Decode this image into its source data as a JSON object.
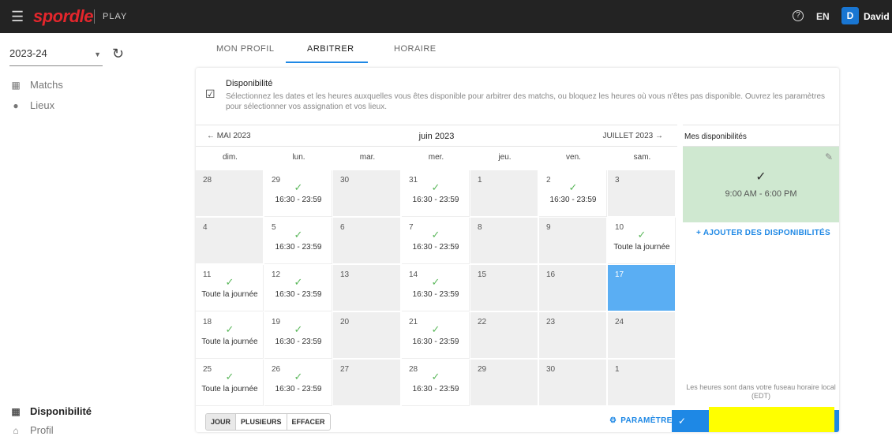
{
  "topbar": {
    "menu_icon": "menu-icon",
    "brand": "spordle",
    "product": "PLAY",
    "help_icon": "help-icon",
    "help_glyph": "?",
    "language": "EN",
    "user_initial": "D",
    "user_name": "David"
  },
  "sidebar": {
    "season": "2023-24",
    "items": [
      {
        "label": "Matchs",
        "icon": "matches-icon"
      },
      {
        "label": "Lieux",
        "icon": "location-pin-icon"
      }
    ],
    "bottom_items": [
      {
        "label": "Disponibilité",
        "icon": "calendar-icon"
      },
      {
        "label": "Profil",
        "icon": "home-icon"
      }
    ]
  },
  "tabs": [
    "MON PROFIL",
    "ARBITRER",
    "HORAIRE"
  ],
  "active_tab": "ARBITRER",
  "availability": {
    "title": "Disponibilité",
    "description": "Sélectionnez les dates et les heures auxquelles vous êtes disponible pour arbitrer des matchs, ou bloquez les heures où vous n'êtes pas disponible. Ouvrez les paramètres pour sélectionner vos assignation et vos lieux."
  },
  "calendar": {
    "prev_month": "← MAI 2023",
    "current_month": "juin 2023",
    "next_month": "JUILLET 2023 →",
    "weekdays": [
      "dim.",
      "lun.",
      "mar.",
      "mer.",
      "jeu.",
      "ven.",
      "sam."
    ],
    "weeks": [
      [
        {
          "day": "28",
          "style": "grey"
        },
        {
          "day": "29",
          "style": "white",
          "avail": true,
          "hours": "16:30 - 23:59"
        },
        {
          "day": "30",
          "style": "grey"
        },
        {
          "day": "31",
          "style": "white",
          "avail": true,
          "hours": "16:30 - 23:59"
        },
        {
          "day": "1",
          "style": "grey"
        },
        {
          "day": "2",
          "style": "white",
          "avail": true,
          "hours": "16:30 - 23:59"
        },
        {
          "day": "3",
          "style": "grey"
        }
      ],
      [
        {
          "day": "4",
          "style": "grey"
        },
        {
          "day": "5",
          "style": "white",
          "avail": true,
          "hours": "16:30 - 23:59"
        },
        {
          "day": "6",
          "style": "grey"
        },
        {
          "day": "7",
          "style": "white",
          "avail": true,
          "hours": "16:30 - 23:59"
        },
        {
          "day": "8",
          "style": "grey"
        },
        {
          "day": "9",
          "style": "grey"
        },
        {
          "day": "10",
          "style": "white",
          "avail": true,
          "hours": "Toute la journée"
        }
      ],
      [
        {
          "day": "11",
          "style": "white",
          "avail": true,
          "hours": "Toute la journée"
        },
        {
          "day": "12",
          "style": "white",
          "avail": true,
          "hours": "16:30 - 23:59"
        },
        {
          "day": "13",
          "style": "grey"
        },
        {
          "day": "14",
          "style": "white",
          "avail": true,
          "hours": "16:30 - 23:59"
        },
        {
          "day": "15",
          "style": "grey"
        },
        {
          "day": "16",
          "style": "grey"
        },
        {
          "day": "17",
          "style": "blue"
        }
      ],
      [
        {
          "day": "18",
          "style": "white",
          "avail": true,
          "hours": "Toute la journée"
        },
        {
          "day": "19",
          "style": "white",
          "avail": true,
          "hours": "16:30 - 23:59"
        },
        {
          "day": "20",
          "style": "grey"
        },
        {
          "day": "21",
          "style": "white",
          "avail": true,
          "hours": "16:30 - 23:59"
        },
        {
          "day": "22",
          "style": "grey"
        },
        {
          "day": "23",
          "style": "grey"
        },
        {
          "day": "24",
          "style": "grey"
        }
      ],
      [
        {
          "day": "25",
          "style": "white",
          "avail": true,
          "hours": "Toute la journée"
        },
        {
          "day": "26",
          "style": "white",
          "avail": true,
          "hours": "16:30 - 23:59"
        },
        {
          "day": "27",
          "style": "grey"
        },
        {
          "day": "28",
          "style": "white",
          "avail": true,
          "hours": "16:30 - 23:59"
        },
        {
          "day": "29",
          "style": "grey"
        },
        {
          "day": "30",
          "style": "grey"
        },
        {
          "day": "1",
          "style": "grey"
        }
      ]
    ]
  },
  "panel": {
    "title": "Mes disponibilités",
    "slot_range": "9:00 AM - 6:00 PM",
    "add_label": "+ AJOUTER DES DISPONIBILITÉS",
    "timezone_note": "Les heures sont dans votre fuseau horaire local (EDT)"
  },
  "footer": {
    "mode_buttons": [
      "JOUR",
      "PLUSIEURS",
      "EFFACER"
    ],
    "active_mode": "JOUR",
    "params_label": "PARAMÈTRES"
  },
  "colors": {
    "accent": "#1e88e5",
    "brand_red": "#e4262c",
    "selected_day": "#5aaef3",
    "available_box": "#cfe8d0",
    "check_green": "#5cb85c",
    "redaction_yellow": "#ffff00"
  }
}
